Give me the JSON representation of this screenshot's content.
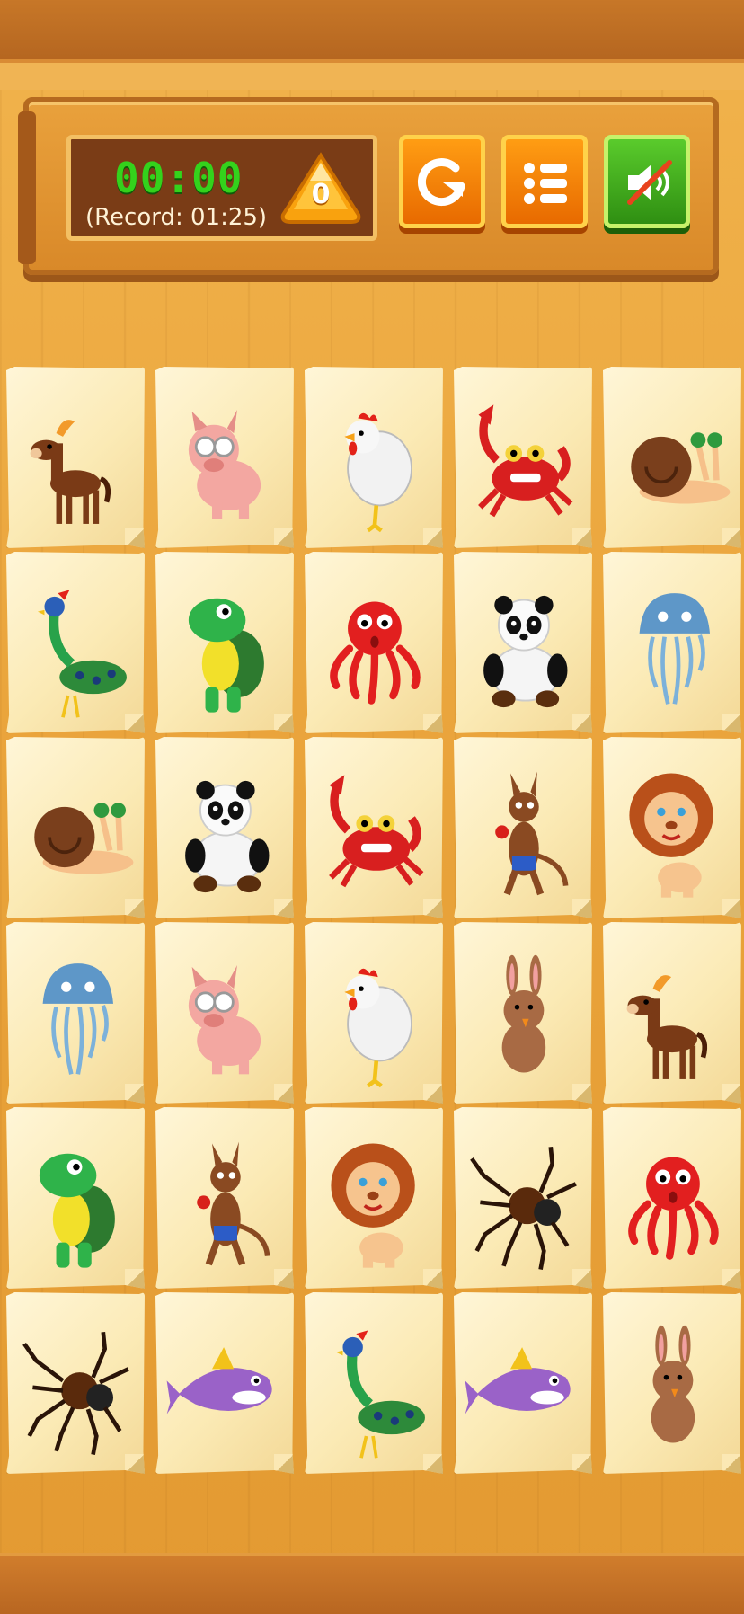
{
  "hud": {
    "timer": "00:00",
    "record": "(Record: 01:25)",
    "score": "0"
  },
  "buttons": [
    {
      "name": "restart-button",
      "icon": "restart-icon"
    },
    {
      "name": "menu-button",
      "icon": "list-menu-icon"
    },
    {
      "name": "sound-toggle-button",
      "icon": "speaker-muted-icon"
    }
  ],
  "colors": {
    "timer_green": "#34d21c",
    "button_orange": "#f58a0b",
    "button_green": "#3da51c",
    "wood": "#e9a33a"
  },
  "board": {
    "columns": 5,
    "rows": 6,
    "cards": [
      [
        "horse",
        "pig",
        "chicken",
        "crab",
        "snail"
      ],
      [
        "peacock",
        "turtle",
        "octopus",
        "panda",
        "jellyfish"
      ],
      [
        "snail",
        "panda",
        "crab",
        "kangaroo",
        "lion"
      ],
      [
        "jellyfish",
        "pig",
        "chicken",
        "rabbit",
        "horse"
      ],
      [
        "turtle",
        "kangaroo",
        "lion",
        "spider",
        "octopus"
      ],
      [
        "spider",
        "dolphin",
        "peacock",
        "dolphin",
        "rabbit"
      ]
    ]
  }
}
